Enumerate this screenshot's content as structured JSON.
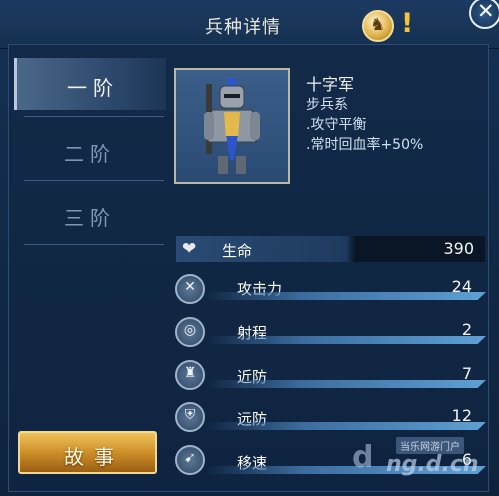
{
  "header": {
    "title": "兵种详情",
    "help_symbol": "!",
    "close_symbol": "✕"
  },
  "tiers": [
    {
      "label": "一阶",
      "active": true
    },
    {
      "label": "二阶",
      "active": false
    },
    {
      "label": "三阶",
      "active": false
    }
  ],
  "story_button": "故事",
  "unit": {
    "name": "十字军",
    "type": "步兵系",
    "trait": ".攻守平衡",
    "regen": ".常时回血率+50%"
  },
  "stats": {
    "hp": {
      "label": "生命",
      "value": "390"
    },
    "rows": [
      {
        "label": "攻击力",
        "value": "24",
        "icon": "crossed-swords-icon",
        "fill": 0.9
      },
      {
        "label": "射程",
        "value": "2",
        "icon": "target-icon",
        "fill": 0.9
      },
      {
        "label": "近防",
        "value": "7",
        "icon": "armor-icon",
        "fill": 0.9
      },
      {
        "label": "远防",
        "value": "12",
        "icon": "shield-icon",
        "fill": 0.9
      },
      {
        "label": "移速",
        "value": "6",
        "icon": "boot-icon",
        "fill": 0.9
      }
    ]
  },
  "watermark": {
    "top": "当乐网游门户",
    "main": "ng.d.cn"
  },
  "colors": {
    "accent_gold": "#f0c25a",
    "panel_blue": "#163154",
    "bar_blue": "#5ea1d4"
  }
}
